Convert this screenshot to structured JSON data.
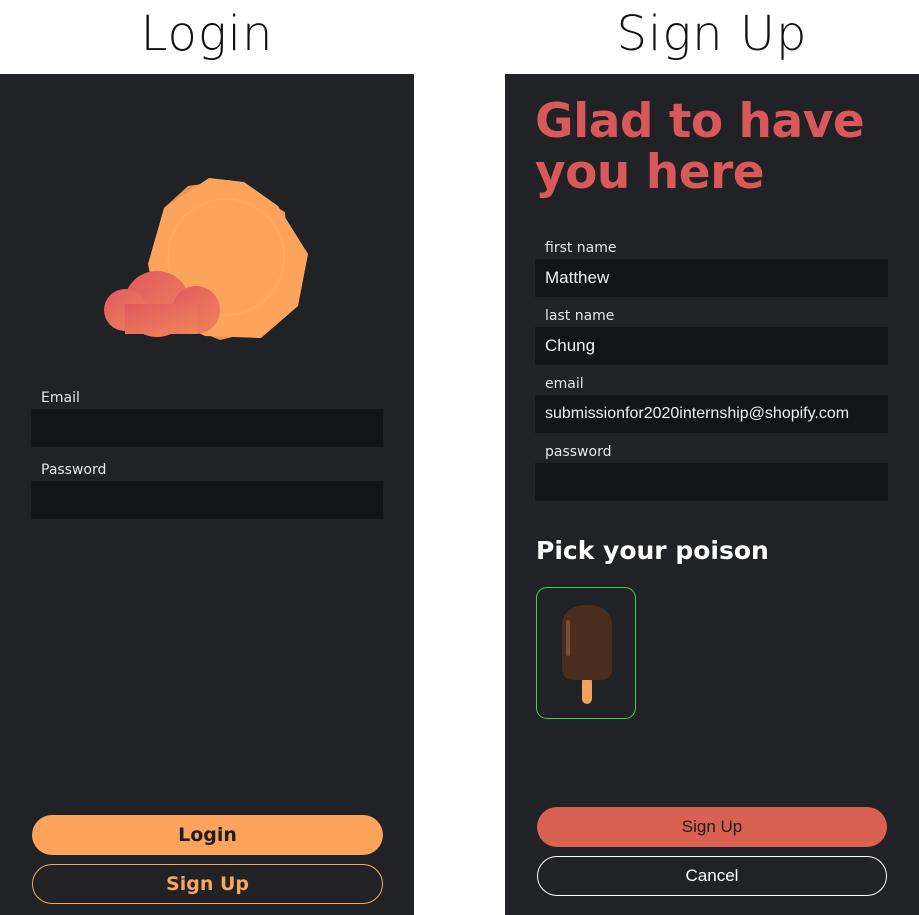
{
  "captions": {
    "left": "Login",
    "right": "Sign Up"
  },
  "colors": {
    "background": "#212225",
    "field": "#131416",
    "accent_orange": "#fca45c",
    "accent_red": "#d9585a",
    "selection_green": "#3ccf55"
  },
  "login": {
    "illustration": "sun-cloud-icon",
    "email_label": "Email",
    "email_value": "",
    "password_label": "Password",
    "password_value": "",
    "login_button": "Login",
    "signup_button": "Sign Up"
  },
  "signup": {
    "headline": "Glad to have you here",
    "fields": {
      "first_name_label": "first name",
      "first_name_value": "Matthew",
      "last_name_label": "last name",
      "last_name_value": "Chung",
      "email_label": "email",
      "email_value": "submissionfor2020internship@shopify.com",
      "password_label": "password",
      "password_value": ""
    },
    "pick_title": "Pick your poison",
    "poison_option": "popsicle-icon",
    "signup_button": "Sign Up",
    "cancel_button": "Cancel"
  }
}
